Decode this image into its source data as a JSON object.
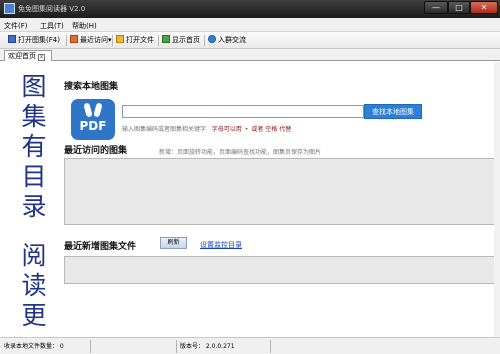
{
  "window": {
    "title": "免免图集阅读器 V2.0",
    "minimize": "—",
    "maximize": "□",
    "close": "✕"
  },
  "menu": [
    "文件(F)",
    "工具(T)",
    "帮助(H)"
  ],
  "toolbar": {
    "open_album": "打开图集(F4)",
    "recent": "最近访问",
    "recent_arrow": "▾",
    "open_file": "打开文件",
    "show_home": "显示首页",
    "join_group": "入群交流"
  },
  "tab": {
    "label": "欢迎首页",
    "close": "x"
  },
  "slogan": [
    "图",
    "集",
    "有",
    "目",
    "录",
    "阅",
    "读",
    "更"
  ],
  "search": {
    "title": "搜索本地图集",
    "logo_text": "PDF",
    "input_value": "",
    "button": "查找本地图集",
    "hint_prefix": "输入图集编码或者图集相关键字",
    "hint_chars": "字母可以用",
    "hint_dot": "•",
    "hint_or": "或者",
    "hint_space": "空格",
    "hint_replace": "代替"
  },
  "recent": {
    "title": "最近访问的图集",
    "description": "新增：页面旋转功能，页面编码查找功能，图集页保存为图片"
  },
  "latest": {
    "title": "最近新增图集文件",
    "refresh": "刷新",
    "monitor_link": "设置监控目录"
  },
  "status": {
    "count_label": "收录本地文件数量： 0",
    "version_label": "版本号： 2.0.0.271"
  },
  "colors": {
    "accent": "#2e7fd6",
    "slogan": "#22338a",
    "titlebar": "#2a2a2a",
    "close": "#c53a24"
  }
}
